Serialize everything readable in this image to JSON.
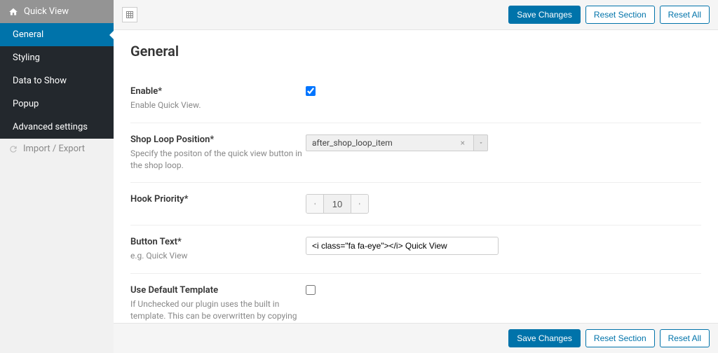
{
  "sidebar": {
    "header": "Quick View",
    "items": [
      {
        "label": "General",
        "active": true
      },
      {
        "label": "Styling",
        "active": false
      },
      {
        "label": "Data to Show",
        "active": false
      },
      {
        "label": "Popup",
        "active": false
      },
      {
        "label": "Advanced settings",
        "active": false
      }
    ],
    "footer": "Import / Export"
  },
  "toolbar": {
    "save": "Save Changes",
    "reset_section": "Reset Section",
    "reset_all": "Reset All"
  },
  "page": {
    "title": "General"
  },
  "fields": {
    "enable": {
      "label": "Enable*",
      "desc": "Enable Quick View.",
      "checked": true
    },
    "shop_loop": {
      "label": "Shop Loop Position*",
      "desc": "Specify the positon of the quick view button in the shop loop.",
      "value": "after_shop_loop_item"
    },
    "hook_priority": {
      "label": "Hook Priority*",
      "value": "10"
    },
    "button_text": {
      "label": "Button Text*",
      "desc": "e.g. Quick View",
      "value": "<i class=\"fa fa-eye\"></i> Quick View"
    },
    "use_default": {
      "label": "Use Default Template",
      "desc": "If Unchecked our plugin uses the built in template. This can be overwritten by copying the FILE public/templates/quick-view.php to your themes folder",
      "checked": false
    }
  }
}
